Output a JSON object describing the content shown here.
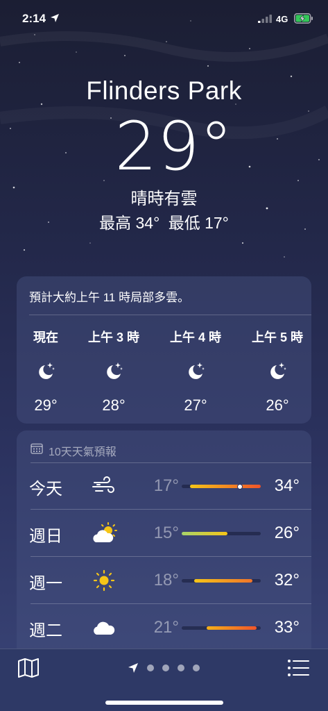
{
  "status_bar": {
    "time": "2:14",
    "network": "4G"
  },
  "hero": {
    "city": "Flinders Park",
    "temperature": "29°",
    "condition": "晴時有雲",
    "high": "最高 34°",
    "low": "最低 17°"
  },
  "hourly": {
    "summary": "預計大約上午 11 時局部多雲。",
    "hours": [
      {
        "label": "現在",
        "icon": "moon-stars-icon",
        "temp": "29°"
      },
      {
        "label": "上午 3 時",
        "icon": "moon-stars-icon",
        "temp": "28°"
      },
      {
        "label": "上午 4 時",
        "icon": "moon-stars-icon",
        "temp": "27°"
      },
      {
        "label": "上午 5 時",
        "icon": "moon-stars-icon",
        "temp": "26°"
      }
    ]
  },
  "daily": {
    "title": "10天天氣預報",
    "range_min": 15,
    "range_max": 34,
    "days": [
      {
        "name": "今天",
        "icon": "wind-icon",
        "low": "17°",
        "high": "34°",
        "low_value": 17,
        "high_value": 34,
        "current_value": 29,
        "bar_colors": [
          "#f5c518",
          "#f0542a"
        ]
      },
      {
        "name": "週日",
        "icon": "partly-sunny-icon",
        "low": "15°",
        "high": "26°",
        "low_value": 15,
        "high_value": 26,
        "bar_colors": [
          "#a8d46a",
          "#f5c518"
        ]
      },
      {
        "name": "週一",
        "icon": "sun-icon",
        "low": "18°",
        "high": "32°",
        "low_value": 18,
        "high_value": 32,
        "bar_colors": [
          "#f5c518",
          "#f0742a"
        ]
      },
      {
        "name": "週二",
        "icon": "cloud-icon",
        "low": "21°",
        "high": "33°",
        "low_value": 21,
        "high_value": 33,
        "bar_colors": [
          "#f5b018",
          "#f0542a"
        ]
      }
    ]
  },
  "toolbar": {
    "page_count": 4,
    "map_icon": "map-icon",
    "list_icon": "list-icon"
  },
  "colors": {
    "background_top": "#1b1e33",
    "background_bottom": "#3a4578",
    "toolbar": "#2e3966"
  }
}
